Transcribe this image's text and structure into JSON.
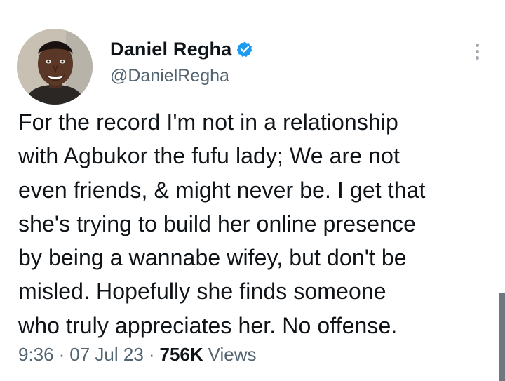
{
  "tweet": {
    "author": {
      "name": "Daniel Regha",
      "handle": "@DanielRegha",
      "verified": true,
      "verified_color": "#1d9bf0"
    },
    "text": "For the record I'm not in a relationship\nwith Agbukor the fufu lady; We are not\neven friends, & might never be. I get that\nshe's trying to build her online presence\nby being a wannabe wifey, but don't be\nmisled. Hopefully she finds someone\nwho truly appreciates her. No offense.",
    "time": "9:36",
    "separator": "·",
    "date": "07 Jul 23",
    "views_count": "756K",
    "views_label": "Views"
  },
  "icons": {
    "verified": "verified-badge-icon",
    "more": "more-vertical-icon"
  }
}
